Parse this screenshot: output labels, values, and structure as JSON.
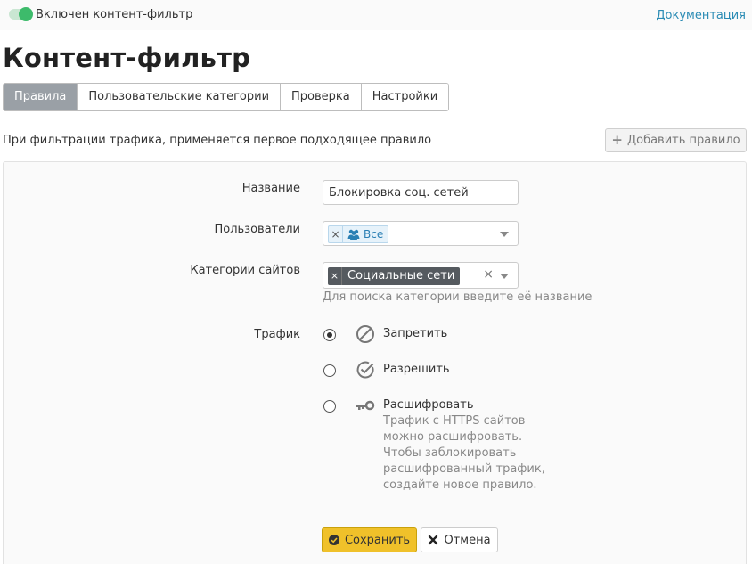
{
  "header": {
    "filter_toggle_label": "Включен контент-фильтр",
    "filter_enabled": true,
    "doc_link": "Документация"
  },
  "page": {
    "title": "Контент-фильтр"
  },
  "tabs": [
    {
      "label": "Правила",
      "active": true
    },
    {
      "label": "Пользовательские категории",
      "active": false
    },
    {
      "label": "Проверка",
      "active": false
    },
    {
      "label": "Настройки",
      "active": false
    }
  ],
  "rules": {
    "hint": "При фильтрации трафика, применяется первое подходящее правило",
    "add_button": "Добавить правило"
  },
  "form": {
    "name_label": "Название",
    "name_value": "Блокировка соц. сетей",
    "users_label": "Пользователи",
    "users_tag": "Все",
    "categories_label": "Категории сайтов",
    "categories_tag": "Социальные сети",
    "categories_help": "Для поиска категории введите её название",
    "traffic_label": "Трафик",
    "traffic_options": [
      {
        "label": "Запретить",
        "icon": "ban-icon",
        "checked": true
      },
      {
        "label": "Разрешить",
        "icon": "check-circle-icon",
        "checked": false
      },
      {
        "label": "Расшифровать",
        "icon": "key-icon",
        "checked": false
      }
    ],
    "decrypt_desc": "Трафик с HTTPS сайтов можно расшифровать. Чтобы заблокировать расшифрованный трафик, создайте новое правило.",
    "save_button": "Сохранить",
    "cancel_button": "Отмена"
  },
  "colors": {
    "toggle_on": "#3dbb6b",
    "link": "#2a8bb4",
    "active_tab": "#9aa0a6",
    "save_button": "#f0c12a",
    "tag_dark": "#555a5f"
  }
}
